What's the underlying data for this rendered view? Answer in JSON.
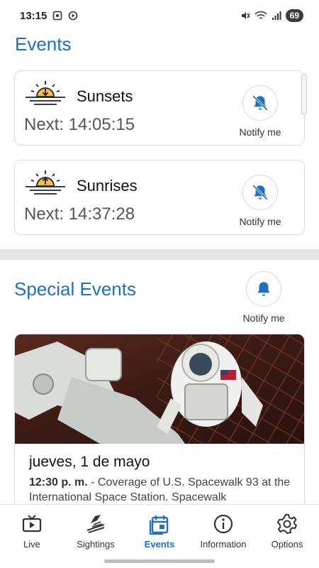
{
  "status_bar": {
    "time": "13:15",
    "battery": "69"
  },
  "header": {
    "title": "Events"
  },
  "events": [
    {
      "name": "Sunsets",
      "next": "Next: 14:05:15",
      "icon": "sunset-icon",
      "notify_label": "Notify me"
    },
    {
      "name": "Sunrises",
      "next": "Next: 14:37:28",
      "icon": "sunrise-icon",
      "notify_label": "Notify me"
    }
  ],
  "special_events": {
    "title": "Special Events",
    "notify_label": "Notify me",
    "items": [
      {
        "date": "jueves, 1 de mayo",
        "time": "12:30 p. m.",
        "description": " - Coverage of U.S. Spacewalk 93 at the International Space Station. Spacewalk"
      }
    ]
  },
  "bottom_nav": [
    {
      "label": "Live",
      "icon": "tv-icon",
      "active": false
    },
    {
      "label": "Sightings",
      "icon": "sightings-icon",
      "active": false
    },
    {
      "label": "Events",
      "icon": "calendar-icon",
      "active": true
    },
    {
      "label": "Information",
      "icon": "info-icon",
      "active": false
    },
    {
      "label": "Options",
      "icon": "gear-icon",
      "active": false
    }
  ],
  "colors": {
    "accent": "#1e6fc8",
    "sun": "#f5c04a",
    "bell": "#1e6fc8"
  }
}
